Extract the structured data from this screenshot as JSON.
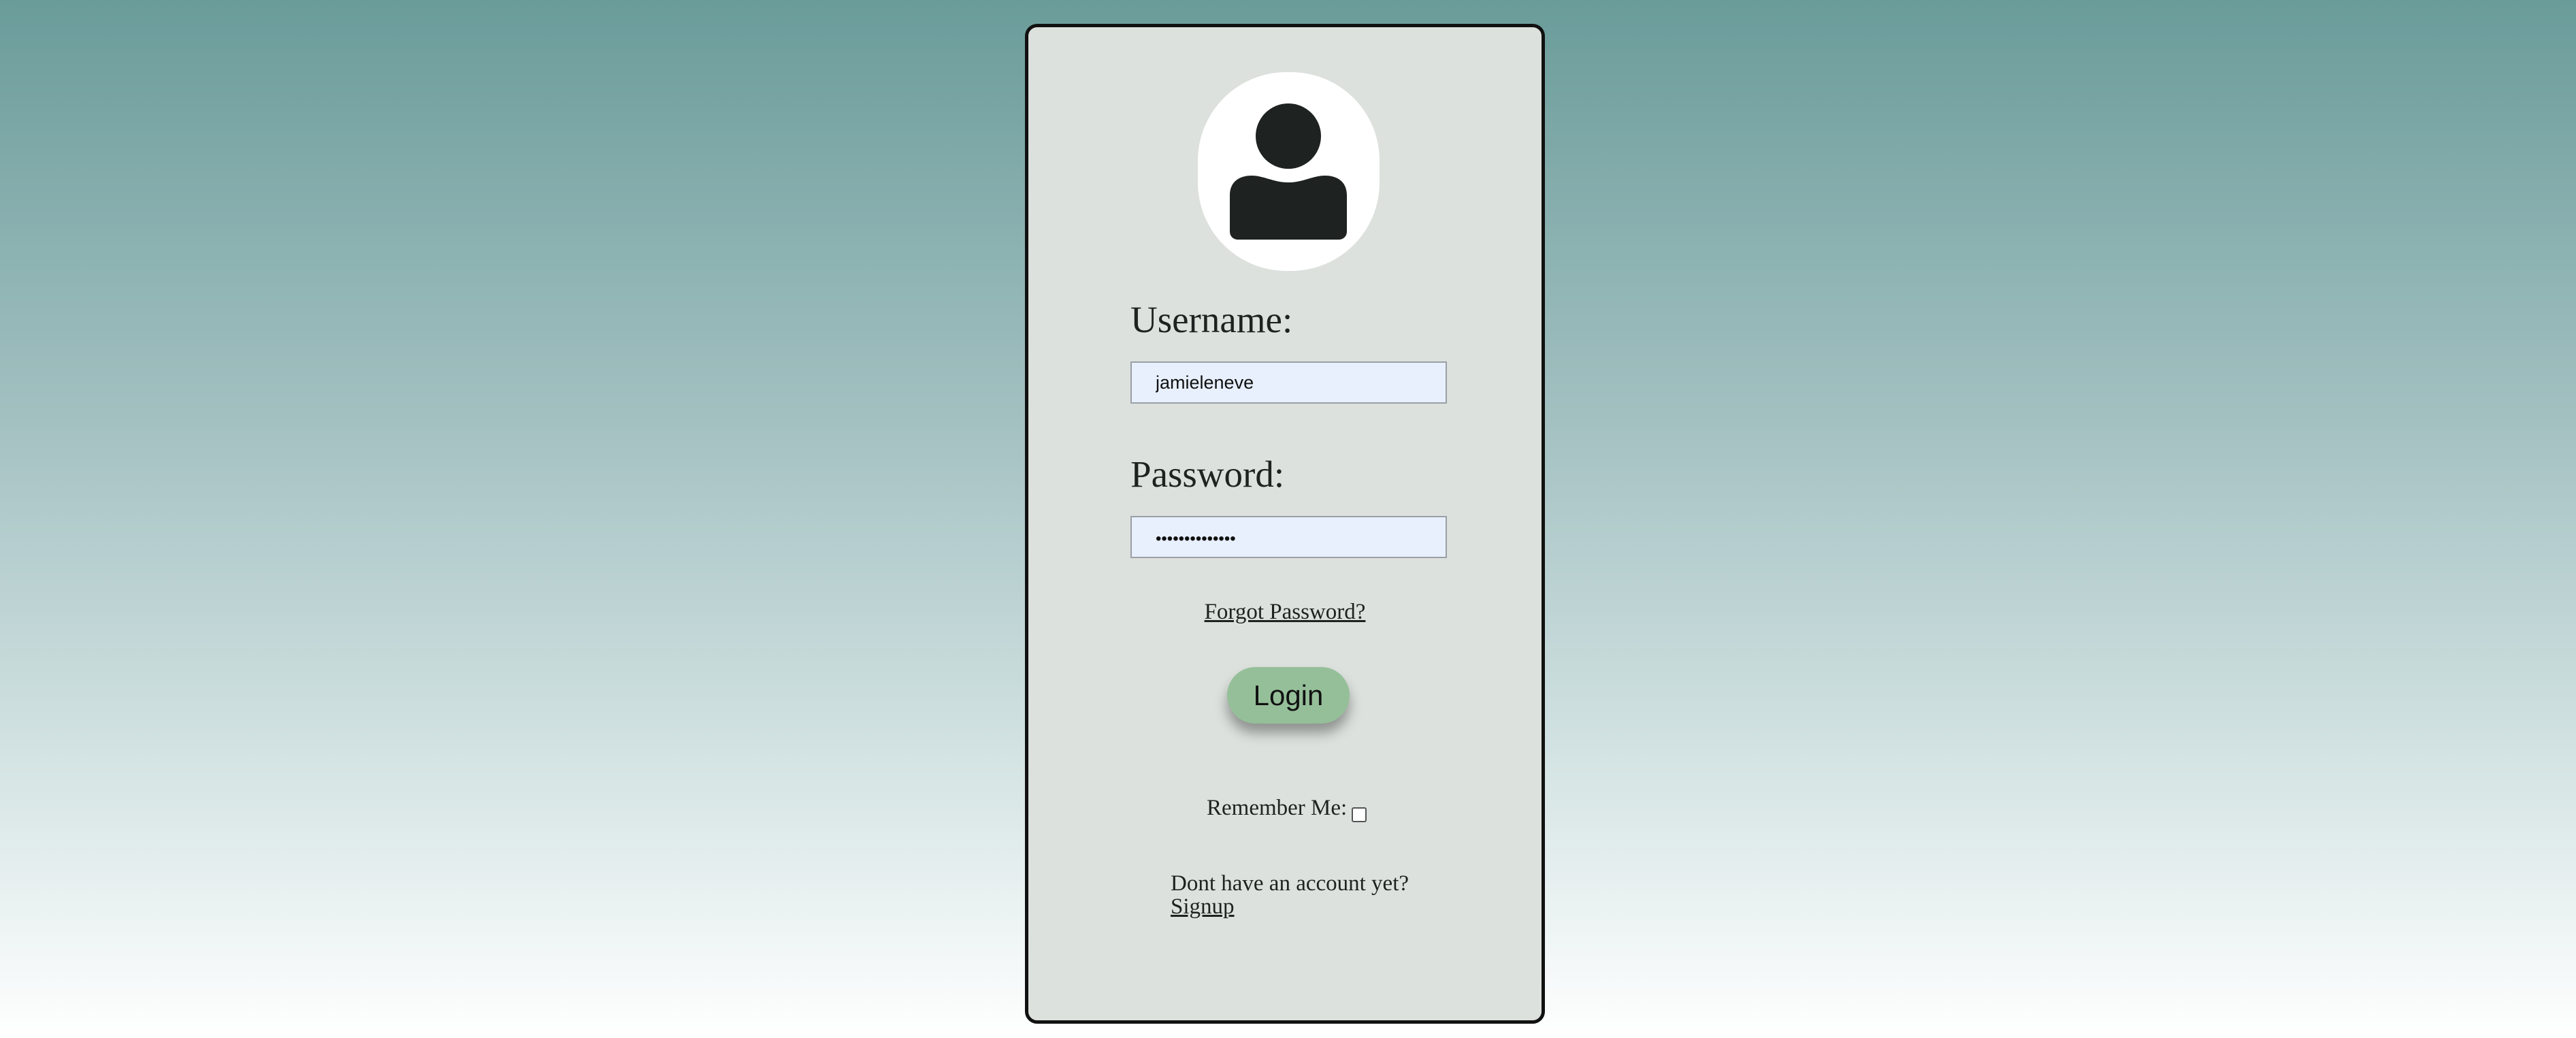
{
  "avatar": {
    "icon": "user-icon",
    "background": "#ffffff",
    "icon_color": "#1e2220"
  },
  "username": {
    "label": "Username:",
    "value": "jamieleneve",
    "placeholder": ""
  },
  "password": {
    "label": "Password:",
    "masked_value": "••••••••••••••"
  },
  "forgot_password": {
    "label": "Forgot Password?"
  },
  "login_button": {
    "label": "Login",
    "color": "#95bf99"
  },
  "remember_me": {
    "label": "Remember Me:",
    "checked": false
  },
  "signup": {
    "prompt": "Dont have an account yet?",
    "link_label": "Signup"
  },
  "colors": {
    "background_top": "#6a9c9a",
    "background_bottom": "#ffffff",
    "card_background": "#dce1dd",
    "card_border": "#111111",
    "input_background": "#e8f0fe"
  }
}
